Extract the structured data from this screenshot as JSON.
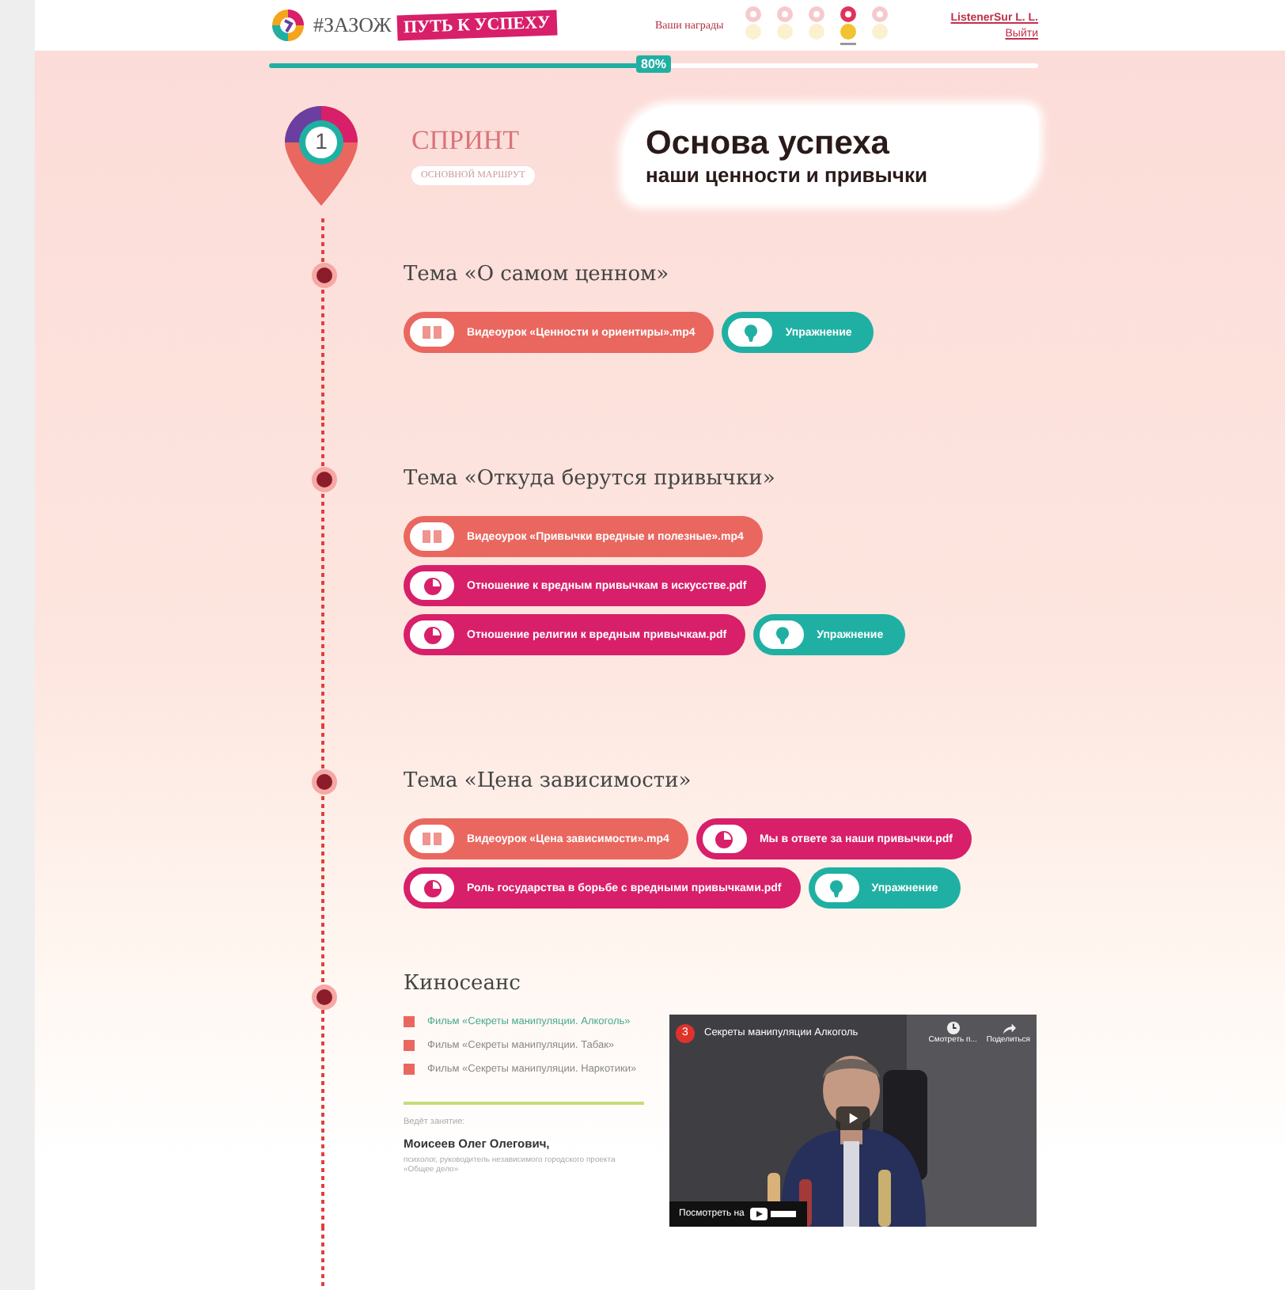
{
  "header": {
    "logo_text": "#ЗАЗОЖ",
    "logo_badge": "ПУТЬ К УСПЕХУ",
    "awards_label": "Ваши награды",
    "awards": [
      {
        "selected": false
      },
      {
        "selected": false
      },
      {
        "selected": false
      },
      {
        "selected": true
      },
      {
        "selected": false
      }
    ],
    "user": "ListenerSur L. L.",
    "logout": "Выйти"
  },
  "progress": {
    "level": 0.5,
    "label": "80%"
  },
  "sprint": {
    "number": "1",
    "label": "СПРИНТ",
    "tag": "ОСНОВНОЙ МАРШРУТ",
    "title": "Основа успеха",
    "subtitle": "наши ценности и привычки"
  },
  "topics": [
    {
      "title": "Тема «О самом ценном»",
      "rows": [
        [
          {
            "kind": "video",
            "label": "Видеоурок «Ценности и ориентиры».mp4"
          },
          {
            "kind": "exercise",
            "label": "Упражнение"
          }
        ]
      ]
    },
    {
      "title": "Тема «Откуда берутся привычки»",
      "rows": [
        [
          {
            "kind": "video",
            "label": "Видеоурок «Привычки вредные и полезные».mp4"
          }
        ],
        [
          {
            "kind": "pdf",
            "label": "Отношение к вредным привычкам в искусстве.pdf"
          }
        ],
        [
          {
            "kind": "pdf",
            "label": "Отношение религии к вредным привычкам.pdf"
          },
          {
            "kind": "exercise",
            "label": "Упражнение"
          }
        ]
      ]
    },
    {
      "title": "Тема «Цена зависимости»",
      "rows": [
        [
          {
            "kind": "video",
            "label": "Видеоурок «Цена зависимости».mp4"
          },
          {
            "kind": "pdf",
            "label": "Мы в ответе за наши привычки.pdf"
          }
        ],
        [
          {
            "kind": "pdf",
            "label": "Роль государства в борьбе с вредными привычками.pdf"
          },
          {
            "kind": "exercise",
            "label": "Упражнение"
          }
        ]
      ]
    }
  ],
  "cinema": {
    "title": "Киносеанс",
    "films": [
      {
        "label": "Фильм «Секреты манипуляции. Алкоголь»",
        "selected": true
      },
      {
        "label": "Фильм «Секреты манипуляции. Табак»",
        "selected": false
      },
      {
        "label": "Фильм «Секреты манипуляции. Наркотики»",
        "selected": false
      }
    ],
    "host_label": "Ведёт занятие:",
    "host_name": "Моисеев Олег Олегович,",
    "host_desc": "психолог, руководитель независимого городского проекта «Общее дело»",
    "video": {
      "number": "3",
      "title": "Секреты манипуляции Алкоголь",
      "watch_later": "Смотреть п...",
      "share": "Поделиться",
      "watch_on": "Посмотреть на"
    }
  }
}
